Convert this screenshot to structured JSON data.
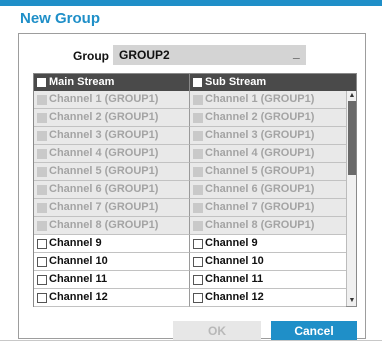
{
  "dialog": {
    "title": "New Group",
    "group_label": "Group",
    "group_value": "GROUP2",
    "group_cursor": "_"
  },
  "table": {
    "main_header": "Main Stream",
    "sub_header": "Sub Stream",
    "rows": [
      {
        "main": "Channel 1 (GROUP1)",
        "sub": "Channel 1 (GROUP1)",
        "state": "disabled"
      },
      {
        "main": "Channel 2 (GROUP1)",
        "sub": "Channel 2 (GROUP1)",
        "state": "disabled"
      },
      {
        "main": "Channel 3 (GROUP1)",
        "sub": "Channel 3 (GROUP1)",
        "state": "disabled"
      },
      {
        "main": "Channel 4 (GROUP1)",
        "sub": "Channel 4 (GROUP1)",
        "state": "disabled"
      },
      {
        "main": "Channel 5 (GROUP1)",
        "sub": "Channel 5 (GROUP1)",
        "state": "disabled"
      },
      {
        "main": "Channel 6 (GROUP1)",
        "sub": "Channel 6 (GROUP1)",
        "state": "disabled"
      },
      {
        "main": "Channel 7 (GROUP1)",
        "sub": "Channel 7 (GROUP1)",
        "state": "disabled"
      },
      {
        "main": "Channel 8 (GROUP1)",
        "sub": "Channel 8 (GROUP1)",
        "state": "disabled"
      },
      {
        "main": "Channel 9",
        "sub": "Channel 9",
        "state": "enabled"
      },
      {
        "main": "Channel 10",
        "sub": "Channel 10",
        "state": "enabled"
      },
      {
        "main": "Channel 11",
        "sub": "Channel 11",
        "state": "enabled"
      },
      {
        "main": "Channel 12",
        "sub": "Channel 12",
        "state": "enabled"
      }
    ]
  },
  "buttons": {
    "ok_label": "OK",
    "cancel_label": "Cancel"
  },
  "colors": {
    "accent": "#1f8fc8",
    "header_bg": "#4a4a4a",
    "disabled_row_bg": "#e9e9e9"
  },
  "icons": {
    "scroll_up": "scroll-up-arrow-icon",
    "scroll_down": "scroll-down-arrow-icon"
  }
}
